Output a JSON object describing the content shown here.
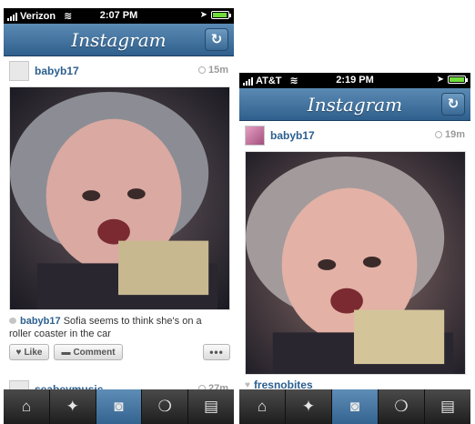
{
  "left": {
    "status": {
      "carrier": "Verizon",
      "time": "2:07 PM",
      "battery_level": 0.85
    },
    "navbar": {
      "title": "Instagram"
    },
    "post": {
      "username": "babyb17",
      "time_ago": "15m",
      "caption_user": "babyb17",
      "caption_text": "Sofia seems to think she's on a roller coaster in the car",
      "like_label": "Like",
      "comment_label": "Comment",
      "more_label": "•••"
    },
    "next_post": {
      "username": "seabeymusic",
      "time_ago": "27m"
    }
  },
  "right": {
    "status": {
      "carrier": "AT&T",
      "time": "2:19 PM",
      "battery_level": 0.9
    },
    "navbar": {
      "title": "Instagram"
    },
    "post": {
      "username": "babyb17",
      "time_ago": "19m"
    },
    "next_post": {
      "username": "fresnobites"
    }
  },
  "tabs": [
    {
      "name": "home",
      "icon": "home-icon"
    },
    {
      "name": "explore",
      "icon": "explore-icon"
    },
    {
      "name": "camera",
      "icon": "camera-icon"
    },
    {
      "name": "news",
      "icon": "news-icon"
    },
    {
      "name": "profile",
      "icon": "profile-icon"
    }
  ],
  "colors": {
    "nav_blue": "#3a6a96",
    "username_blue": "#2b5f8f",
    "tab_active": "#4a7aa6"
  }
}
